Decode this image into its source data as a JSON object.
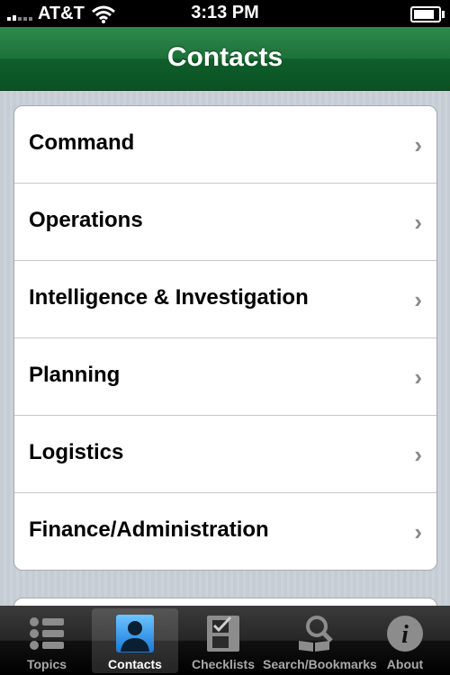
{
  "status_bar": {
    "carrier": "AT&T",
    "time": "3:13 PM"
  },
  "nav": {
    "title": "Contacts"
  },
  "list": {
    "items": [
      {
        "label": "Command"
      },
      {
        "label": "Operations"
      },
      {
        "label": "Intelligence & Investigation"
      },
      {
        "label": "Planning"
      },
      {
        "label": "Logistics"
      },
      {
        "label": "Finance/Administration"
      }
    ]
  },
  "tabs": [
    {
      "label": "Topics",
      "icon": "list-icon"
    },
    {
      "label": "Contacts",
      "icon": "person-icon",
      "active": true
    },
    {
      "label": "Checklists",
      "icon": "checklist-icon"
    },
    {
      "label": "Search/Bookmarks",
      "icon": "search-book-icon"
    },
    {
      "label": "About",
      "icon": "info-icon"
    }
  ],
  "colors": {
    "nav_green": "#1c7139",
    "tab_active_blue": "#1e90e0"
  }
}
